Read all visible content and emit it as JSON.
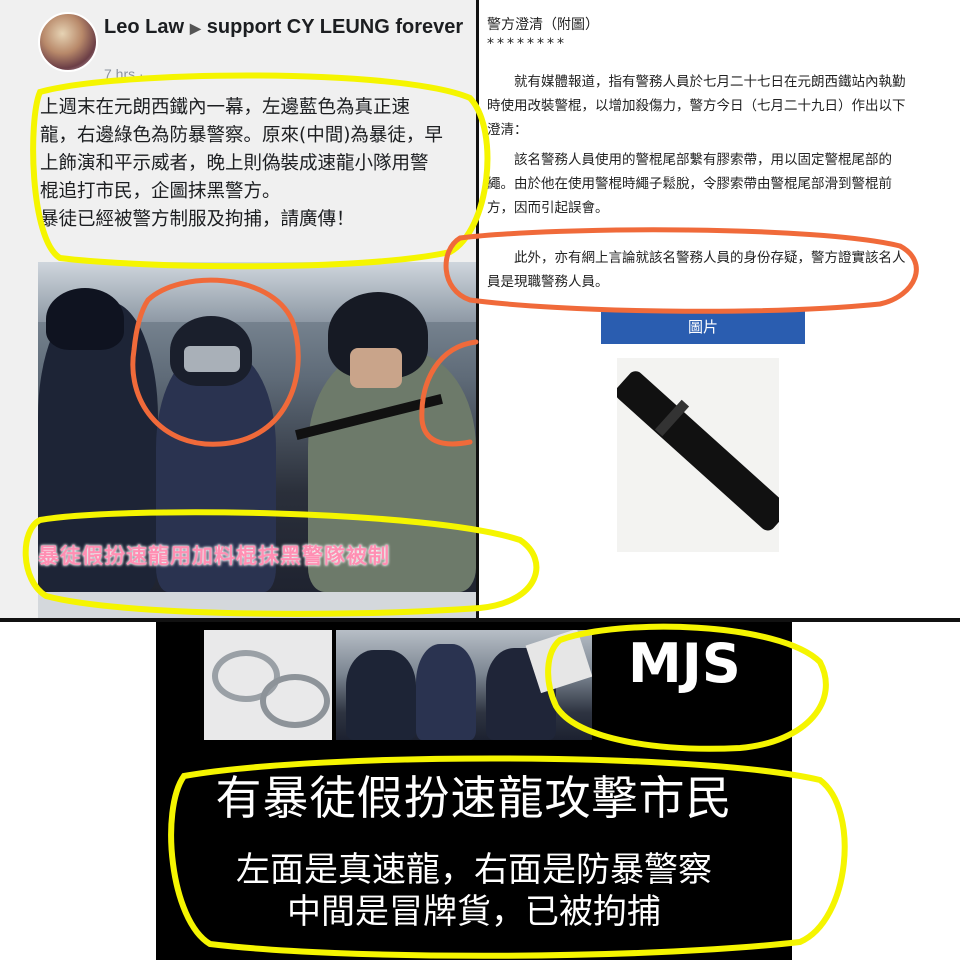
{
  "post": {
    "author": "Leo  Law",
    "target": "support CY LEUNG forever",
    "time": "7 hrs ·",
    "text_lines": [
      "上週末在元朗西鐵內一幕，左邊藍色為真正速",
      "龍，右邊綠色為防暴警察。原來(中間)為暴徒，早",
      "上飾演和平示威者，晚上則偽裝成速龍小隊用警",
      "棍追打市民，企圖抹黑警方。",
      "暴徒已經被警方制服及拘捕，請廣傳！"
    ],
    "photo_caption": "暴徒假扮速龍用加料棍抹黑警隊被制"
  },
  "notice": {
    "title": "警方澄清（附圖）",
    "stars": "********",
    "para1": "　　就有媒體報道，指有警務人員於七月二十七日在元朗西鐵站內執勤時使用改裝警棍，以增加殺傷力，警方今日（七月二十九日）作出以下澄清：",
    "para2": "　　該名警務人員使用的警棍尾部繫有膠索帶，用以固定警棍尾部的繩。由於他在使用警棍時繩子鬆脫，令膠索帶由警棍尾部滑到警棍前方，因而引起誤會。",
    "para3": "　　此外，亦有網上言論就該名警務人員的身份存疑，警方證實該名人員是現職警務人員。",
    "button_label": "圖片"
  },
  "bottom": {
    "logo": "MJS",
    "headline": "有暴徒假扮速龍攻擊市民",
    "line1": "左面是真速龍，右面是防暴警察",
    "line2": "中間是冒牌貨，已被拘捕"
  },
  "colors": {
    "annotation_yellow": "#f5f500",
    "annotation_orange": "#f06a3a",
    "button_blue": "#2a5db0"
  }
}
